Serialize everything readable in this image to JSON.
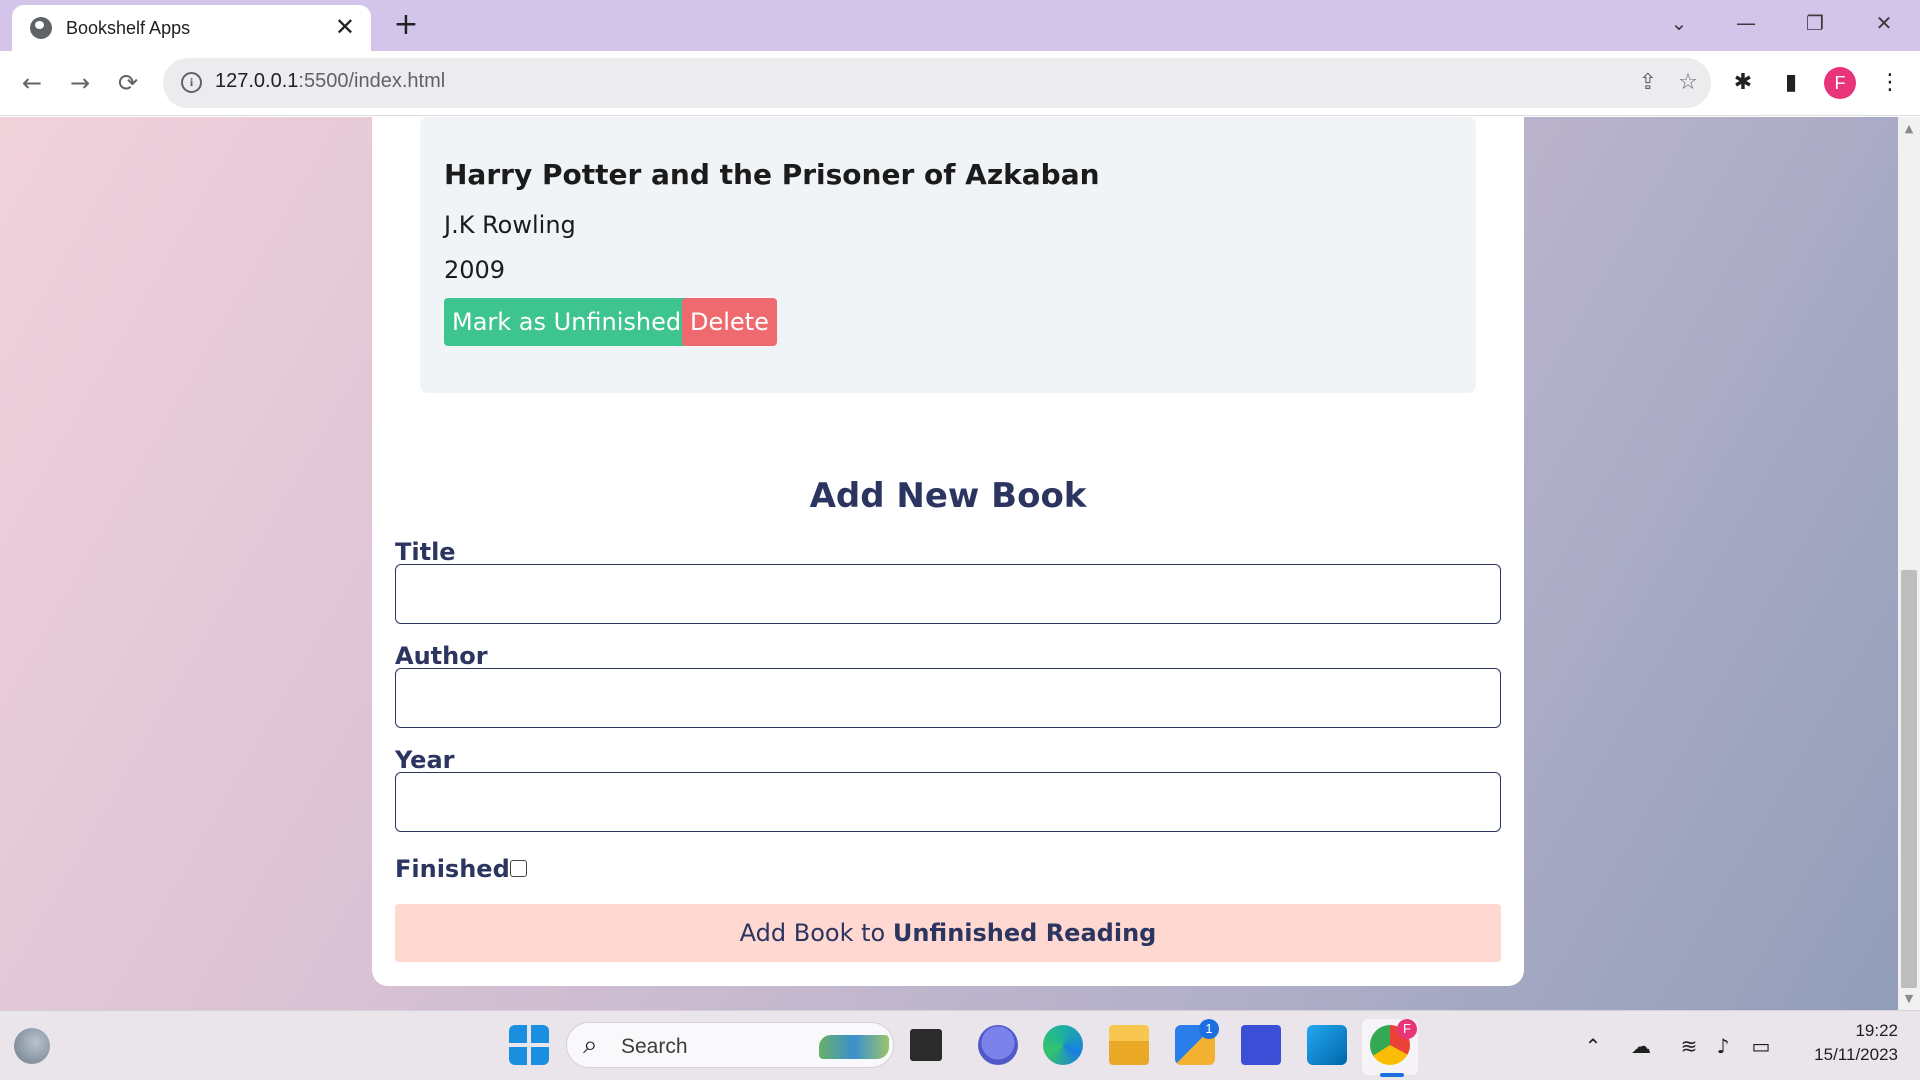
{
  "browser": {
    "tab_title": "Bookshelf Apps",
    "tab_close": "✕",
    "new_tab": "+",
    "url_host": "127.0.0.1",
    "url_path": ":5500/index.html",
    "profile_initial": "F",
    "window_controls": [
      "⌄",
      "—",
      "❐",
      "✕"
    ]
  },
  "book": {
    "title": "Harry Potter and the Prisoner of Azkaban",
    "author": "J.K Rowling",
    "year": "2009",
    "toggle_label": "Mark as Unfinished",
    "delete_label": "Delete"
  },
  "form": {
    "heading": "Add New Book",
    "title_label": "Title",
    "author_label": "Author",
    "year_label": "Year",
    "title_value": "",
    "author_value": "",
    "year_value": "",
    "finished_label": "Finished",
    "finished_checked": false,
    "submit_prefix": "Add Book to ",
    "submit_target": "Unfinished Reading"
  },
  "taskbar": {
    "search_placeholder": "Search",
    "store_badge": "1",
    "chrome_badge": "F",
    "time": "19:22",
    "date": "15/11/2023"
  },
  "colors": {
    "accent_green": "#3ec48e",
    "accent_red": "#ee6a6e",
    "heading_navy": "#2b3560",
    "submit_bg": "#ffd8d2",
    "titlebar": "#d3c5ea"
  }
}
